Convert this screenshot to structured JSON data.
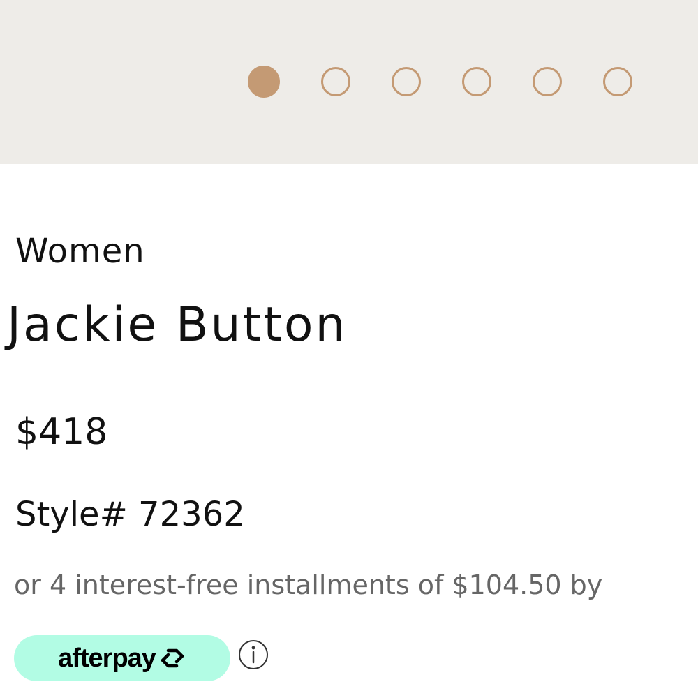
{
  "carousel": {
    "slide_count": 6,
    "active_index": 0,
    "dot_color": "#c49a74",
    "band_color": "#eeece8"
  },
  "product": {
    "category": "Women",
    "name": "Jackie Button",
    "price": "$418",
    "style_number": "Style# 72362",
    "installments_text": "or 4 interest-free installments of $104.50 by"
  },
  "afterpay": {
    "label": "afterpay",
    "badge_color": "#b2fce4",
    "logo_icon": "afterpay-arrows-icon",
    "info_icon": "info-icon"
  }
}
